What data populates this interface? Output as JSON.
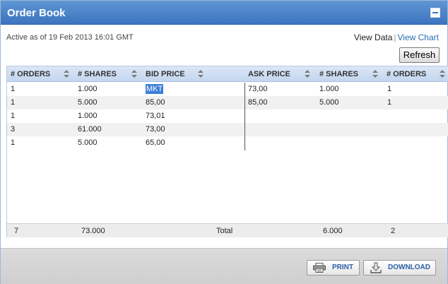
{
  "window": {
    "title": "Order Book"
  },
  "status_text": "Active as of 19 Feb 2013 16:01 GMT",
  "view": {
    "data_label": "View Data",
    "separator": "|",
    "chart_label": "View Chart"
  },
  "refresh_label": "Refresh",
  "columns": [
    "# ORDERS",
    "# SHARES",
    "BID PRICE",
    "ASK PRICE",
    "# SHARES",
    "# ORDERS"
  ],
  "bids": [
    {
      "orders": "1",
      "shares": "1.000",
      "price": "MKT"
    },
    {
      "orders": "1",
      "shares": "5.000",
      "price": "85,00"
    },
    {
      "orders": "1",
      "shares": "1.000",
      "price": "73,01"
    },
    {
      "orders": "3",
      "shares": "61.000",
      "price": "73,00"
    },
    {
      "orders": "1",
      "shares": "5.000",
      "price": "65,00"
    }
  ],
  "asks": [
    {
      "price": "73,00",
      "shares": "1.000",
      "orders": "1"
    },
    {
      "price": "85,00",
      "shares": "5.000",
      "orders": "1"
    }
  ],
  "totals": {
    "bid_orders": "7",
    "bid_shares": "73.000",
    "label": "Total",
    "ask_shares": "6.000",
    "ask_orders": "2"
  },
  "buttons": {
    "print": "PRINT",
    "download": "DOWNLOAD"
  }
}
